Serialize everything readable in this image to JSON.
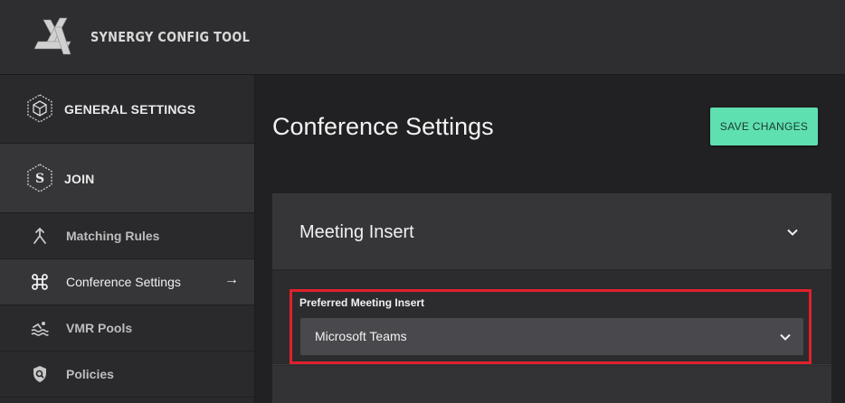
{
  "app": {
    "title": "SYNERGY CONFIG TOOL",
    "logo_icon": "synergy-logo"
  },
  "sidebar": {
    "sections": [
      {
        "label": "GENERAL SETTINGS",
        "icon": "hexagon-cube-icon"
      },
      {
        "label": "JOIN",
        "icon": "hexagon-s-icon"
      }
    ],
    "items": [
      {
        "label": "Matching Rules",
        "icon": "merge-arrow-icon",
        "active": false
      },
      {
        "label": "Conference Settings",
        "icon": "command-key-icon",
        "active": true,
        "arrow": "→"
      },
      {
        "label": "VMR Pools",
        "icon": "swimmer-icon",
        "active": false
      },
      {
        "label": "Policies",
        "icon": "shield-search-icon",
        "active": false
      }
    ]
  },
  "main": {
    "title": "Conference Settings",
    "save_label": "SAVE CHANGES",
    "panel": {
      "title": "Meeting Insert",
      "field_label": "Preferred Meeting Insert",
      "selected_value": "Microsoft Teams"
    }
  },
  "colors": {
    "accent": "#5fe0b0",
    "highlight": "#e0212b",
    "background": "#212123"
  }
}
